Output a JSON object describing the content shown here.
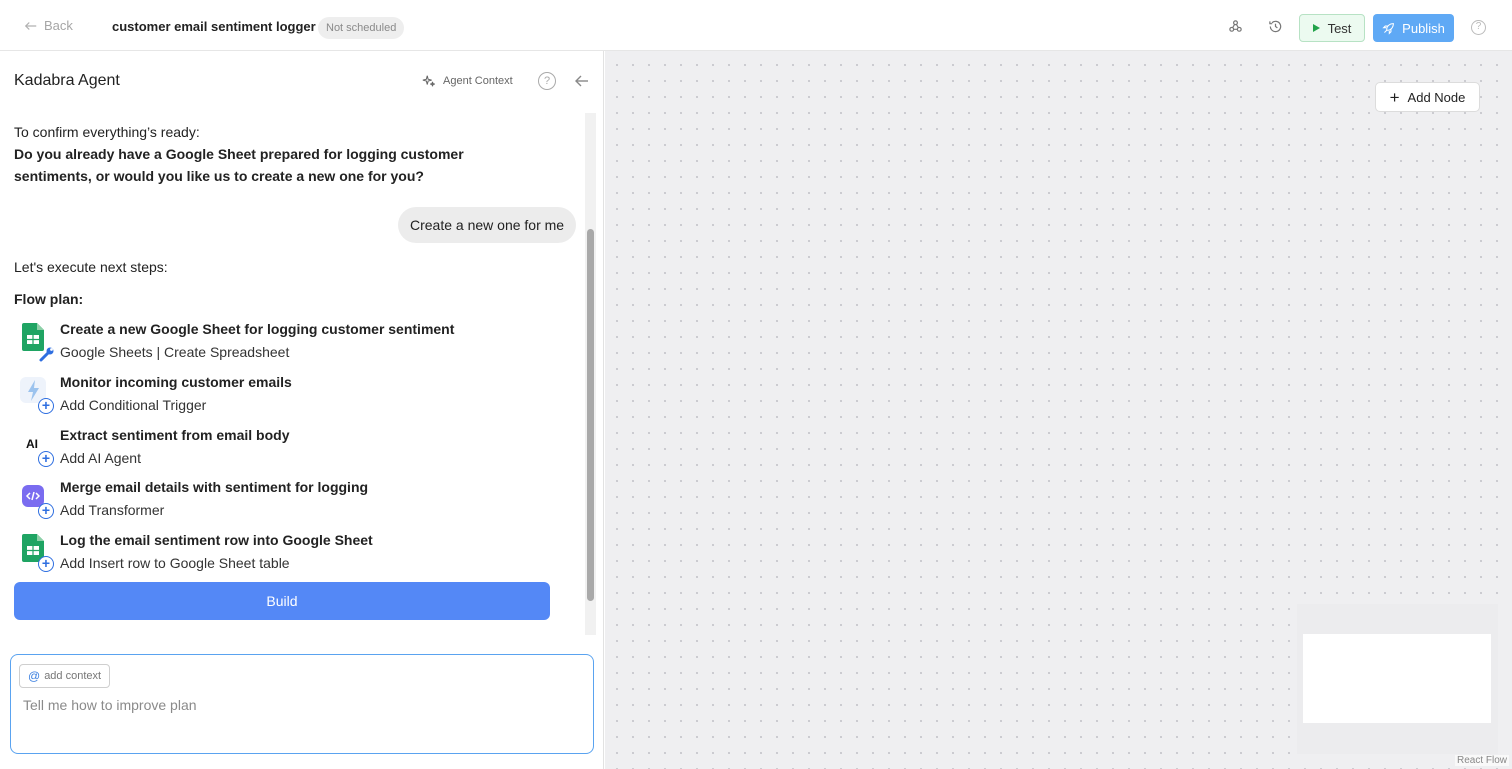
{
  "header": {
    "back_label": "Back",
    "flow_title": "customer email sentiment logger",
    "schedule_badge": "Not scheduled",
    "test_label": "Test",
    "publish_label": "Publish",
    "help_glyph": "?"
  },
  "panel": {
    "title": "Kadabra Agent",
    "agent_context_label": "Agent Context",
    "help_glyph": "?"
  },
  "chat": {
    "confirm_line": "To confirm everything’s ready:",
    "question": "Do you already have a Google Sheet prepared for logging customer sentiments, or would you like us to create a new one for you?",
    "user_reply": "Create a new one for me",
    "next_steps": "Let's execute next steps:",
    "plan_heading": "Flow plan:",
    "steps": [
      {
        "title": "Create a new Google Sheet for logging customer sentiment",
        "subtitle": "Google Sheets | Create Spreadsheet",
        "icon": "google-sheets-icon"
      },
      {
        "title": "Monitor incoming customer emails",
        "subtitle": "Add Conditional Trigger",
        "icon": "lightning-icon"
      },
      {
        "title": "Extract sentiment from email body",
        "subtitle": "Add AI Agent",
        "icon": "ai-icon"
      },
      {
        "title": "Merge email details with sentiment for logging",
        "subtitle": "Add Transformer",
        "icon": "code-icon"
      },
      {
        "title": "Log the email sentiment row into Google Sheet",
        "subtitle": "Add Insert row to Google Sheet table",
        "icon": "google-sheets-icon"
      }
    ],
    "build_label": "Build"
  },
  "composer": {
    "context_chip": "add context",
    "context_at": "@",
    "placeholder": "Tell me how to improve plan"
  },
  "canvas": {
    "add_node_label": "Add Node",
    "attribution": "React Flow"
  },
  "colors": {
    "primary": "#5488f6",
    "publish": "#5fa9f5",
    "test_bg": "#ecfaf0",
    "sheets_green": "#1fa463"
  }
}
